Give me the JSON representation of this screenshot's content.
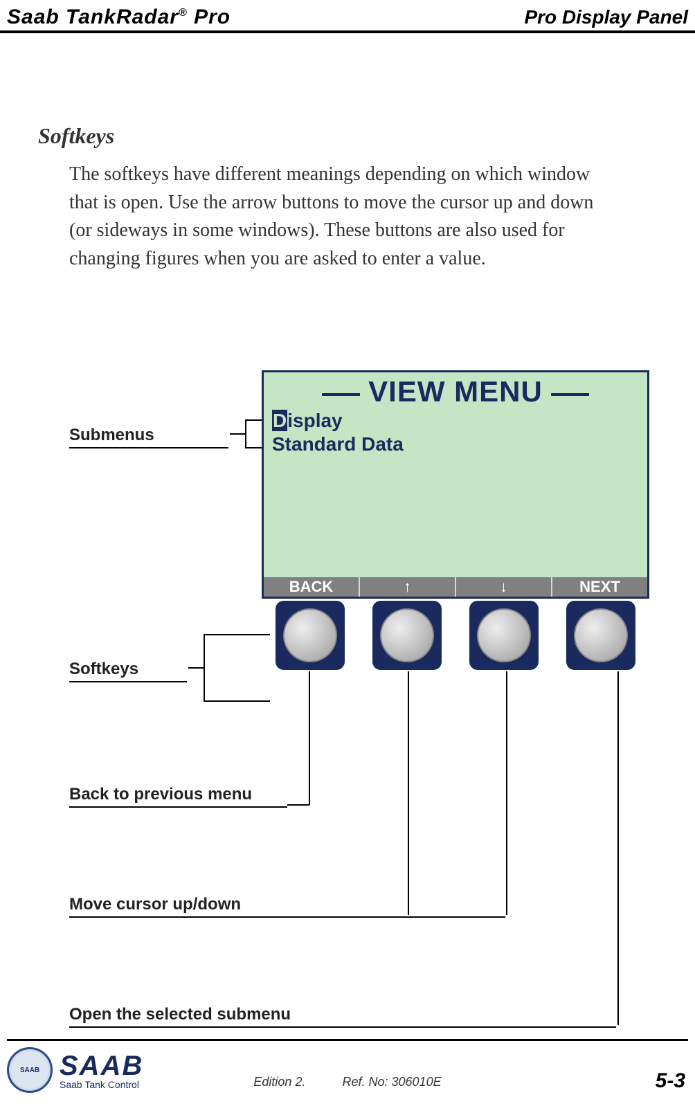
{
  "header": {
    "product_left": "Saab TankRadar® Pro",
    "section_right": "Pro Display Panel"
  },
  "section": {
    "title": "Softkeys",
    "body": "The softkeys have different meanings depending on which window that is open. Use the arrow buttons to move the cursor up and down (or sideways in some windows). These buttons are also used for changing figures when you are asked to enter a value."
  },
  "diagram": {
    "labels": {
      "submenus": "Submenus",
      "softkeys": "Softkeys",
      "back": "Back to previous menu",
      "updown": "Move cursor up/down",
      "open": "Open the selected submenu"
    },
    "screen": {
      "title": "VIEW MENU",
      "items": [
        "Display",
        "Standard Data"
      ],
      "selected_index": 0,
      "softkeys": [
        "BACK",
        "↑",
        "↓",
        "NEXT"
      ]
    }
  },
  "footer": {
    "brand": "SAAB",
    "brand_sub": "Saab Tank Control",
    "badge_text": "SAAB",
    "edition": "Edition 2.",
    "ref": "Ref. No: 306010E",
    "page": "5-3"
  }
}
